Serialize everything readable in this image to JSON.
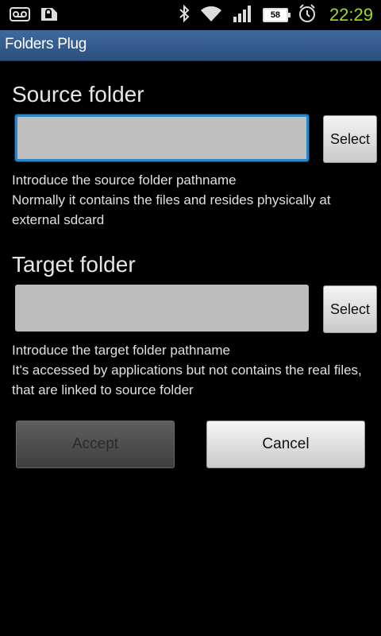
{
  "status_bar": {
    "time": "22:29",
    "battery_level": "58",
    "icons": [
      "voicemail-icon",
      "lock-icon",
      "bluetooth-icon",
      "wifi-icon",
      "signal-icon",
      "battery-icon",
      "alarm-icon"
    ]
  },
  "app": {
    "title": "Folders Plug"
  },
  "source": {
    "heading": "Source folder",
    "value": "",
    "select_label": "Select",
    "help_line1": "Introduce the source folder pathname",
    "help_line2": "Normally it contains the files and resides physically at external sdcard"
  },
  "target": {
    "heading": "Target folder",
    "value": "",
    "select_label": "Select",
    "help_line1": "Introduce the target folder pathname",
    "help_line2": "It's accessed by applications but not contains the real files, that are linked to source folder"
  },
  "actions": {
    "accept": "Accept",
    "cancel": "Cancel"
  },
  "colors": {
    "accent": "#2b86c8",
    "clock": "#9fdc1a",
    "titlebar": "#3f6a9f"
  }
}
